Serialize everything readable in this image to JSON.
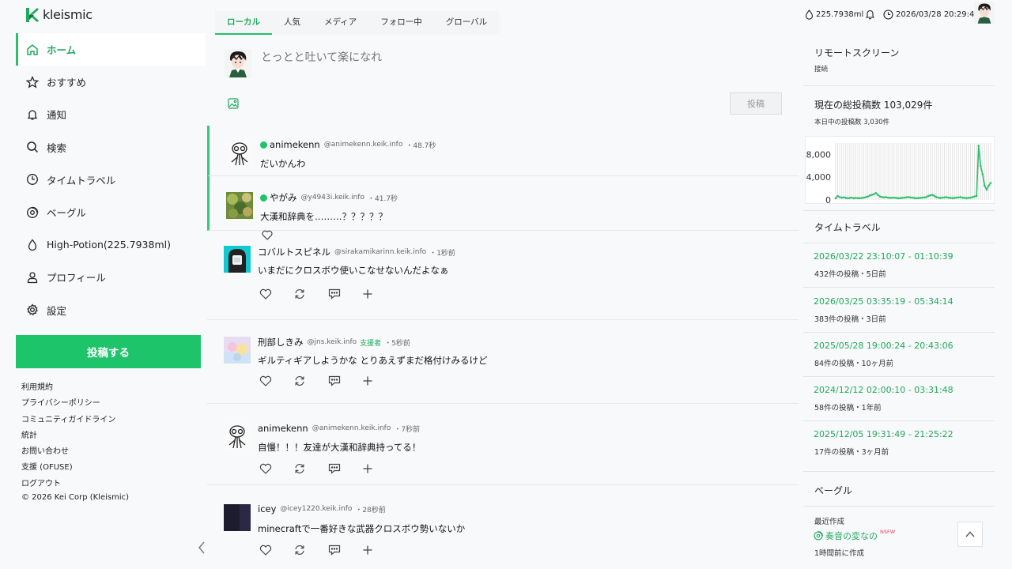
{
  "app": {
    "logo_text": "kleismic"
  },
  "nav": {
    "items": [
      {
        "label": "ホーム",
        "icon": "home-icon"
      },
      {
        "label": "おすすめ",
        "icon": "star-icon"
      },
      {
        "label": "通知",
        "icon": "bell-icon"
      },
      {
        "label": "検索",
        "icon": "search-icon"
      },
      {
        "label": "タイムトラベル",
        "icon": "clock-icon"
      },
      {
        "label": "ベーグル",
        "icon": "bagel-icon"
      },
      {
        "label": "High-Potion(225.7938ml)",
        "icon": "drop-icon"
      },
      {
        "label": "プロフィール",
        "icon": "user-icon"
      },
      {
        "label": "設定",
        "icon": "gear-icon"
      }
    ],
    "post_button": "投稿する"
  },
  "footer": {
    "links": [
      "利用規約",
      "プライバシーポリシー",
      "コミュニティガイドライン",
      "統計",
      "お問い合わせ",
      "支援 (OFUSE)",
      "ログアウト"
    ],
    "copyright": "© 2026 Kei Corp (Kleismic)"
  },
  "tabs": [
    "ローカル",
    "人気",
    "メディア",
    "フォロー中",
    "グローバル"
  ],
  "composer": {
    "placeholder": "とっとと吐いて楽になれ",
    "submit": "投稿"
  },
  "posts": [
    {
      "name": "animekenn",
      "acct": "@animekenn.keik.info",
      "time": "48.7秒",
      "body": "だいかんわ",
      "online": true
    },
    {
      "name": "やがみ",
      "acct": "@y4943i.keik.info",
      "time": "41.7秒",
      "body": "大漢和辞典を………？？？？？",
      "online": true
    },
    {
      "name": "コバルトスピネル",
      "acct": "@sirakamikarinn.keik.info",
      "time": "1秒前",
      "body": "いまだにクロスボウ使いこなせないんだよなぁ"
    },
    {
      "name": "刑部しきみ",
      "acct": "@jns.keik.info",
      "supporter": "支援者",
      "time": "5秒前",
      "body": "ギルティギアしようかな とりあえずまだ格付けみるけど"
    },
    {
      "name": "animekenn",
      "acct": "@animekenn.keik.info",
      "time": "7秒前",
      "body": "自慢！！！友達が大漢和辞典持ってる！"
    },
    {
      "name": "icey",
      "acct": "@icey1220.keik.info",
      "time": "28秒前",
      "body": "minecraftで一番好きな武器クロスボウ勢いないか"
    }
  ],
  "topbar": {
    "potion": "225.7938ml",
    "datetime": "2026/03/28 20:29:44"
  },
  "remote": {
    "title": "リモートスクリーン",
    "status": "接続"
  },
  "stats": {
    "title": "現在の総投稿数 103,029件",
    "today": "本日中の投稿数 3,030件"
  },
  "chart_data": {
    "type": "line",
    "y_ticks": [
      "8,000",
      "4,000",
      "0"
    ],
    "ylim": [
      0,
      10000
    ],
    "grid": true,
    "values": [
      300,
      700,
      500,
      400,
      450,
      350,
      300,
      350,
      400,
      300,
      350,
      300,
      320,
      340,
      400,
      500,
      600,
      800,
      900,
      1000,
      1200,
      900,
      600,
      500,
      450,
      500,
      400,
      350,
      380,
      400,
      350,
      300,
      320,
      350,
      400,
      450,
      500,
      450,
      400,
      350,
      300,
      320,
      350,
      400,
      450,
      500,
      700,
      800,
      900,
      700,
      500,
      400,
      350,
      400,
      450,
      500,
      400,
      350,
      300,
      350,
      400,
      450,
      500,
      400,
      350,
      300,
      350,
      400,
      500,
      600,
      700,
      9500,
      6000,
      4500,
      2500,
      1800,
      2500,
      3000
    ]
  },
  "timetravel": {
    "title": "タイムトラベル",
    "items": [
      {
        "range": "2026/03/22 23:10:07 - 01:10:39",
        "info": "432件の投稿・5日前"
      },
      {
        "range": "2026/03/25 03:35:19 - 05:34:14",
        "info": "383件の投稿・3日前"
      },
      {
        "range": "2025/05/28 19:00:24 - 20:43:06",
        "info": "84件の投稿・10ヶ月前"
      },
      {
        "range": "2024/12/12 02:00:10 - 03:31:48",
        "info": "58件の投稿・1年前"
      },
      {
        "range": "2025/12/05 19:31:49 - 21:25:22",
        "info": "17件の投稿・3ヶ月前"
      }
    ]
  },
  "bagel": {
    "title": "ベーグル",
    "recent_label": "最近作成",
    "item_name": "奏音の変なの",
    "nsfw": "NSFW",
    "created": "1時間前に作成"
  },
  "colors": {
    "accent": "#1ec46a",
    "accent_text": "#1fa95c"
  }
}
